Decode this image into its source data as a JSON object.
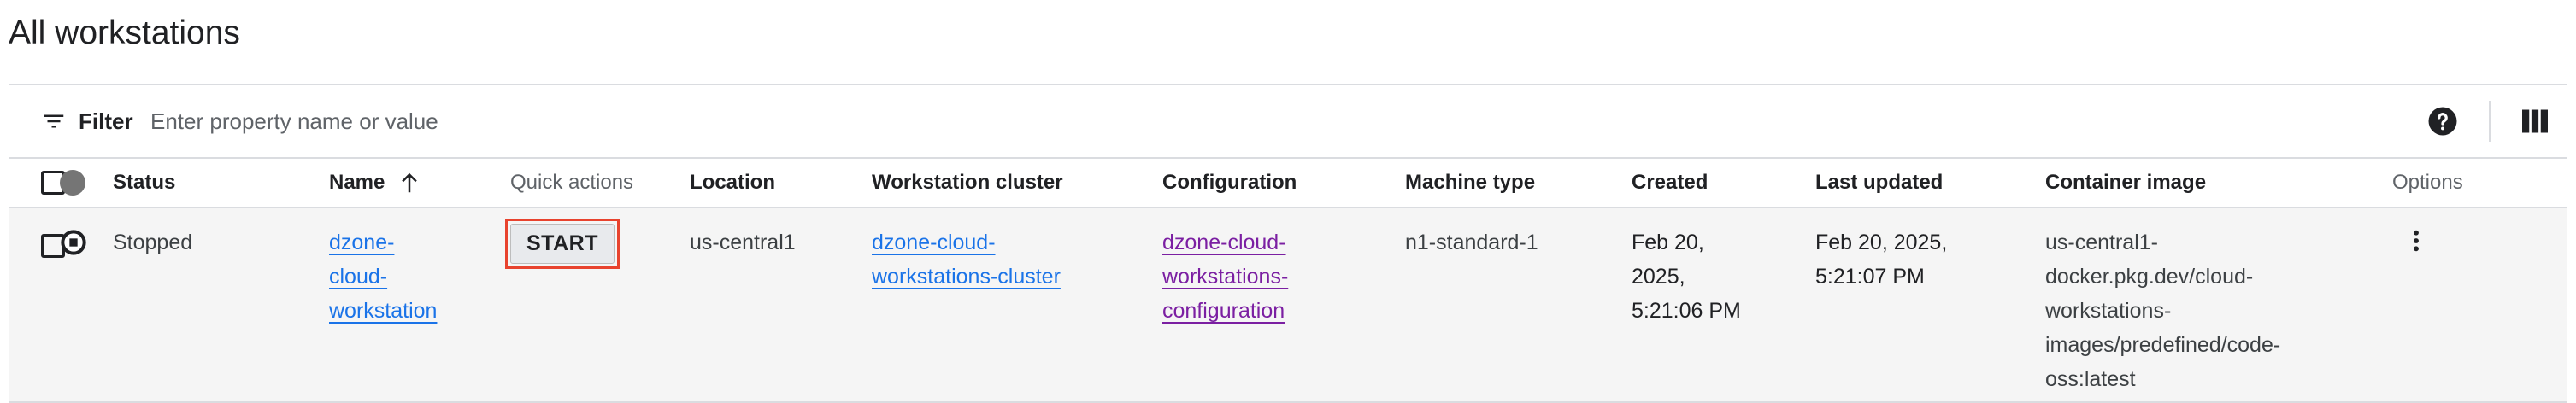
{
  "page": {
    "title": "All workstations"
  },
  "filter": {
    "label": "Filter",
    "placeholder": "Enter property name or value"
  },
  "icons": {
    "filter": "filter-icon",
    "help": "help-icon",
    "columns": "column-display-icon",
    "sort": "arrow-upward-icon",
    "status": "stop-circle-icon",
    "options": "more-vert-icon"
  },
  "colors": {
    "link": "#1a73e8",
    "visited_link": "#7b1fa2",
    "highlight": "#e8432e",
    "row_bg": "#f5f5f5"
  },
  "table": {
    "columns": {
      "status": "Status",
      "name": "Name",
      "quick_actions": "Quick actions",
      "location": "Location",
      "cluster": "Workstation cluster",
      "configuration": "Configuration",
      "machine_type": "Machine type",
      "created": "Created",
      "last_updated": "Last updated",
      "container_image": "Container image",
      "options": "Options"
    },
    "rows": [
      {
        "status": "Stopped",
        "name": [
          "dzone-",
          "cloud-",
          "workstation"
        ],
        "action": "START",
        "location": "us-central1",
        "cluster": [
          "dzone-cloud-",
          "workstations-cluster"
        ],
        "configuration": [
          "dzone-cloud-",
          "workstations-",
          "configuration"
        ],
        "machine_type": "n1-standard-1",
        "created": [
          "Feb 20,",
          "2025,",
          "5:21:06 PM"
        ],
        "last_updated": [
          "Feb 20, 2025,",
          "5:21:07 PM"
        ],
        "container_image": [
          "us-central1-",
          "docker.pkg.dev/cloud-",
          "workstations-",
          "images/predefined/code-",
          "oss:latest"
        ]
      }
    ]
  }
}
